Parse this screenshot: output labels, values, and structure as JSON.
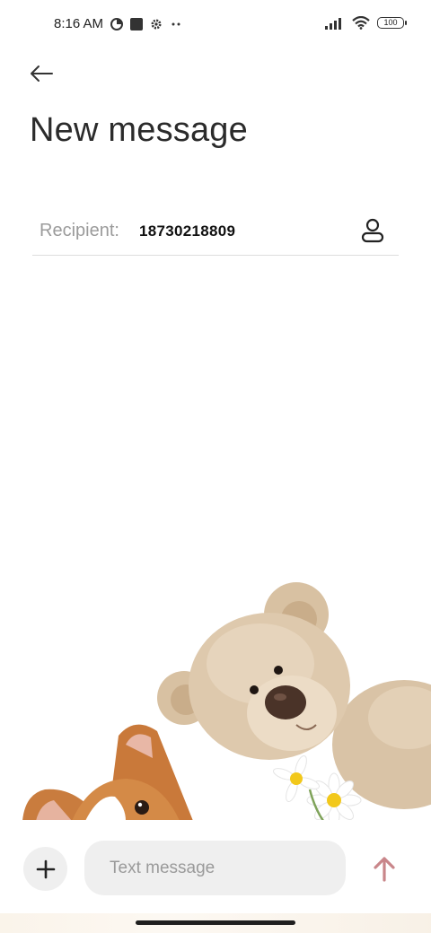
{
  "status_bar": {
    "time": "8:16 AM",
    "battery": "100",
    "icons": [
      "data-saver-icon",
      "square-notification-icon",
      "settings-gear-icon",
      "more-dots-icon",
      "signal-icon",
      "wifi-icon",
      "battery-icon"
    ]
  },
  "header": {
    "title": "New message"
  },
  "recipient": {
    "label": "Recipient:",
    "value": "18730218809"
  },
  "composer": {
    "placeholder": "Text message"
  },
  "colors": {
    "send_arrow": "#c9868a",
    "field_bg": "#efefef",
    "divider": "#dddddd"
  }
}
